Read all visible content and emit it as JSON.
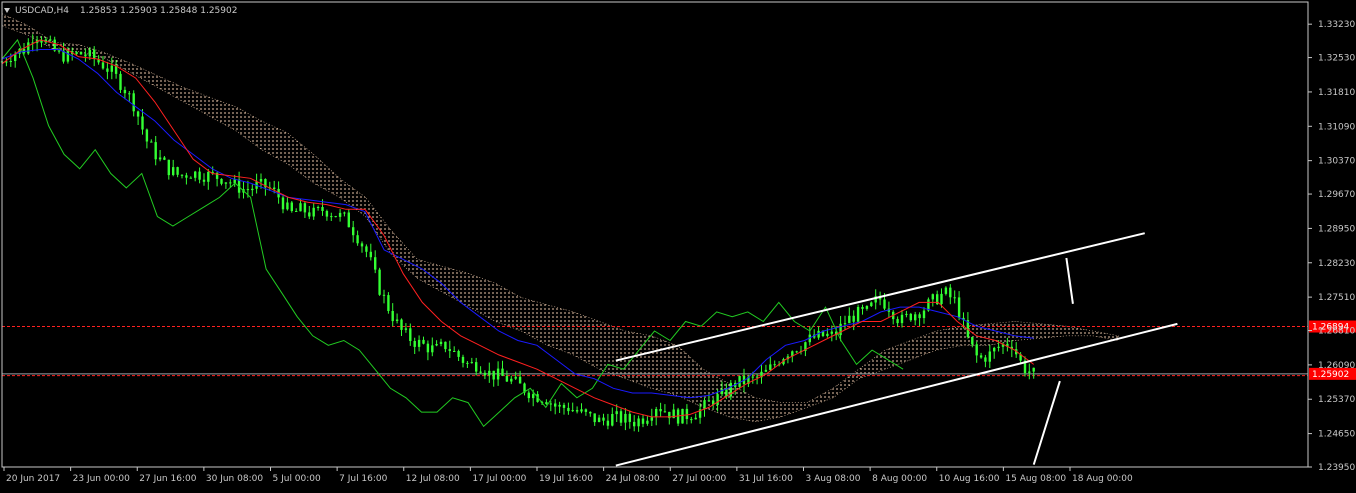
{
  "header": {
    "symbol": "USDCAD,H4",
    "ohlc": "1.25853 1.25903 1.25848 1.25902",
    "menu_icon": "triangle-down-icon"
  },
  "colors": {
    "background": "#000000",
    "frame": "#c8c8c8",
    "axis_text": "#c8c8c8",
    "candle": "#33ff33",
    "tenkan": "#ff2020",
    "kijun": "#1a1aff",
    "chikou": "#22cc22",
    "cloud": "#f5d0b0",
    "channel": "#ffffff",
    "level": "#ff2020",
    "bid": "#9aa0a6",
    "price_tag": "#ff0000"
  },
  "chart_data": {
    "type": "candlestick",
    "symbol": "USDCAD",
    "timeframe": "H4",
    "ylim": [
      1.2395,
      1.3359
    ],
    "y_ticks": [
      "1.33230",
      "1.32530",
      "1.31810",
      "1.31090",
      "1.30370",
      "1.29670",
      "1.28950",
      "1.28230",
      "1.27510",
      "1.26810",
      "1.26090",
      "1.25370",
      "1.24650",
      "1.23950"
    ],
    "x_ticks": [
      "20 Jun 2017",
      "23 Jun 00:00",
      "27 Jun 16:00",
      "30 Jun 08:00",
      "5 Jul 00:00",
      "7 Jul 16:00",
      "12 Jul 08:00",
      "17 Jul 00:00",
      "19 Jul 16:00",
      "24 Jul 08:00",
      "27 Jul 00:00",
      "31 Jul 16:00",
      "3 Aug 08:00",
      "8 Aug 00:00",
      "10 Aug 16:00",
      "15 Aug 08:00",
      "18 Aug 00:00"
    ],
    "price_labels": [
      {
        "value": 1.26894,
        "text": "1.26894",
        "kind": "level"
      },
      {
        "value": 1.25902,
        "text": "1.25902",
        "kind": "current"
      }
    ],
    "bid_line": 1.25902,
    "close_path": [
      1.3245,
      1.3262,
      1.327,
      1.3305,
      1.3285,
      1.326,
      1.3255,
      1.3262,
      1.3255,
      1.324,
      1.322,
      1.319,
      1.315,
      1.308,
      1.3045,
      1.302,
      1.3005,
      1.3012,
      1.3008,
      1.3005,
      1.3,
      1.2985,
      1.2975,
      1.2985,
      1.2982,
      1.296,
      1.2925,
      1.2935,
      1.2925,
      1.2935,
      1.2925,
      1.2915,
      1.288,
      1.284,
      1.277,
      1.272,
      1.268,
      1.266,
      1.265,
      1.264,
      1.265,
      1.263,
      1.261,
      1.261,
      1.259,
      1.2585,
      1.2575,
      1.256,
      1.2545,
      1.254,
      1.252,
      1.252,
      1.251,
      1.25,
      1.249,
      1.25,
      1.2495,
      1.249,
      1.25,
      1.2525,
      1.251,
      1.25,
      1.2505,
      1.2515,
      1.2535,
      1.2545,
      1.257,
      1.2575,
      1.258,
      1.2595,
      1.262,
      1.264,
      1.265,
      1.2665,
      1.267,
      1.267,
      1.27,
      1.2715,
      1.272,
      1.275,
      1.273,
      1.27,
      1.2715,
      1.2725,
      1.2745,
      1.276,
      1.274,
      1.2665,
      1.262,
      1.263,
      1.265,
      1.2655,
      1.2605,
      1.259
    ],
    "tenkan_path": [
      1.324,
      1.327,
      1.329,
      1.328,
      1.3255,
      1.325,
      1.3235,
      1.321,
      1.316,
      1.31,
      1.304,
      1.301,
      1.3005,
      1.3,
      1.298,
      1.296,
      1.295,
      1.2945,
      1.2935,
      1.2935,
      1.288,
      1.28,
      1.274,
      1.27,
      1.267,
      1.265,
      1.263,
      1.2615,
      1.26,
      1.258,
      1.256,
      1.254,
      1.2525,
      1.251,
      1.25,
      1.25,
      1.2505,
      1.252,
      1.2545,
      1.257,
      1.259,
      1.262,
      1.264,
      1.266,
      1.268,
      1.27,
      1.27,
      1.272,
      1.274,
      1.274,
      1.27,
      1.267,
      1.266,
      1.264,
      1.261
    ],
    "kijun_path": [
      1.325,
      1.3265,
      1.327,
      1.327,
      1.325,
      1.322,
      1.318,
      1.315,
      1.312,
      1.308,
      1.305,
      1.302,
      1.3,
      1.299,
      1.2975,
      1.296,
      1.2955,
      1.295,
      1.2945,
      1.293,
      1.285,
      1.283,
      1.281,
      1.278,
      1.274,
      1.271,
      1.268,
      1.266,
      1.265,
      1.262,
      1.259,
      1.258,
      1.256,
      1.255,
      1.255,
      1.2545,
      1.254,
      1.2545,
      1.256,
      1.258,
      1.262,
      1.265,
      1.266,
      1.268,
      1.269,
      1.27,
      1.272,
      1.273,
      1.273,
      1.272,
      1.271,
      1.269,
      1.268,
      1.267,
      1.2665
    ],
    "chikou_path": [
      1.325,
      1.329,
      1.321,
      1.311,
      1.305,
      1.302,
      1.306,
      1.301,
      1.298,
      1.301,
      1.292,
      1.29,
      1.292,
      1.294,
      1.296,
      1.299,
      1.296,
      1.281,
      1.276,
      1.271,
      1.267,
      1.265,
      1.266,
      1.264,
      1.26,
      1.256,
      1.254,
      1.251,
      1.251,
      1.254,
      1.253,
      1.248,
      1.251,
      1.254,
      1.256,
      1.252,
      1.257,
      1.254,
      1.256,
      1.261,
      1.26,
      1.264,
      1.268,
      1.266,
      1.27,
      1.269,
      1.272,
      1.271,
      1.272,
      1.27,
      1.274,
      1.27,
      1.268,
      1.273,
      1.266,
      1.261,
      1.264,
      1.262,
      1.26
    ],
    "cloud_upper": [
      1.3345,
      1.332,
      1.3285,
      1.328,
      1.3262,
      1.324,
      1.3215,
      1.319,
      1.317,
      1.315,
      1.312,
      1.3095,
      1.305,
      1.3,
      1.296,
      1.289,
      1.283,
      1.2815,
      1.28,
      1.278,
      1.275,
      1.2735,
      1.272,
      1.27,
      1.268,
      1.267,
      1.265,
      1.26,
      1.257,
      1.254,
      1.253,
      1.253,
      1.256,
      1.26,
      1.264,
      1.266,
      1.268,
      1.269,
      1.2695,
      1.27,
      1.2695,
      1.269,
      1.268,
      1.267
    ],
    "cloud_lower": [
      1.332,
      1.33,
      1.327,
      1.3265,
      1.325,
      1.322,
      1.319,
      1.316,
      1.313,
      1.31,
      1.306,
      1.303,
      1.299,
      1.296,
      1.292,
      1.284,
      1.279,
      1.276,
      1.273,
      1.27,
      1.268,
      1.265,
      1.263,
      1.26,
      1.258,
      1.256,
      1.2545,
      1.252,
      1.25,
      1.249,
      1.25,
      1.252,
      1.254,
      1.258,
      1.26,
      1.262,
      1.264,
      1.265,
      1.265,
      1.266,
      1.2665,
      1.267,
      1.267,
      1.266
    ],
    "channel_upper": [
      [
        0.47,
        1.2618
      ],
      [
        0.875,
        1.2885
      ]
    ],
    "channel_lower": [
      [
        0.47,
        1.2398
      ],
      [
        0.9,
        1.2695
      ]
    ],
    "annotation_lines": [
      [
        [
          0.815,
          1.2833
        ],
        [
          0.82,
          1.2737
        ]
      ],
      [
        [
          0.79,
          1.24
        ],
        [
          0.81,
          1.2575
        ]
      ]
    ],
    "level_lines": [
      1.26894,
      1.25865
    ]
  }
}
